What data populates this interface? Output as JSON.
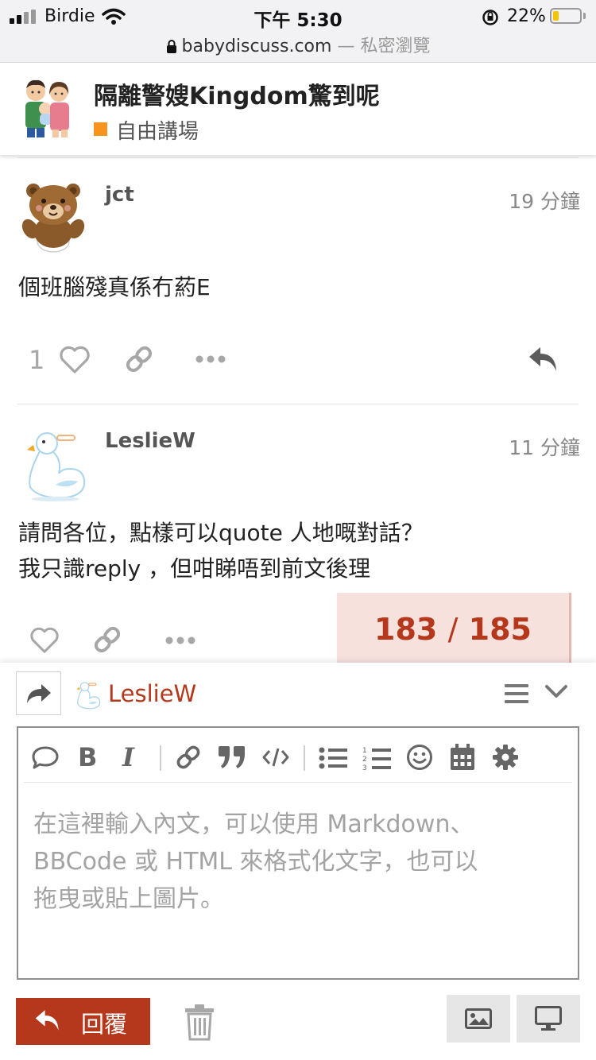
{
  "status_bar": {
    "carrier": "Birdie",
    "time": "下午 5:30",
    "domain": "babydiscuss.com",
    "private_label": "— 私密瀏覽",
    "battery_percent": "22%",
    "battery_level": 0.22
  },
  "topic": {
    "title": "隔離警嫂Kingdom驚到呢",
    "category": "自由講場",
    "category_color": "#f7941d"
  },
  "posts": [
    {
      "username": "jct",
      "time": "19 分鐘",
      "body_lines": [
        "個班腦殘真係冇葯E"
      ],
      "like_count": "1"
    },
    {
      "username": "LeslieW",
      "time": "11 分鐘",
      "body_lines": [
        "請問各位，點樣可以quote 人地嘅對話？",
        "我只識reply ，但咁睇唔到前文後理"
      ]
    }
  ],
  "progress": {
    "current": "183",
    "separator": "/",
    "total": "185"
  },
  "composer": {
    "reply_to_user": "LeslieW",
    "placeholder_lines": [
      "在這裡輸入內文，可以使用 Markdown、",
      "BBCode 或 HTML 來格式化文字，也可以",
      "拖曳或貼上圖片。"
    ],
    "reply_button_label": "回覆"
  },
  "colors": {
    "accent": "#b5381c",
    "progress_bg": "#f6e1dd",
    "icon_gray": "#a7a7a7"
  }
}
